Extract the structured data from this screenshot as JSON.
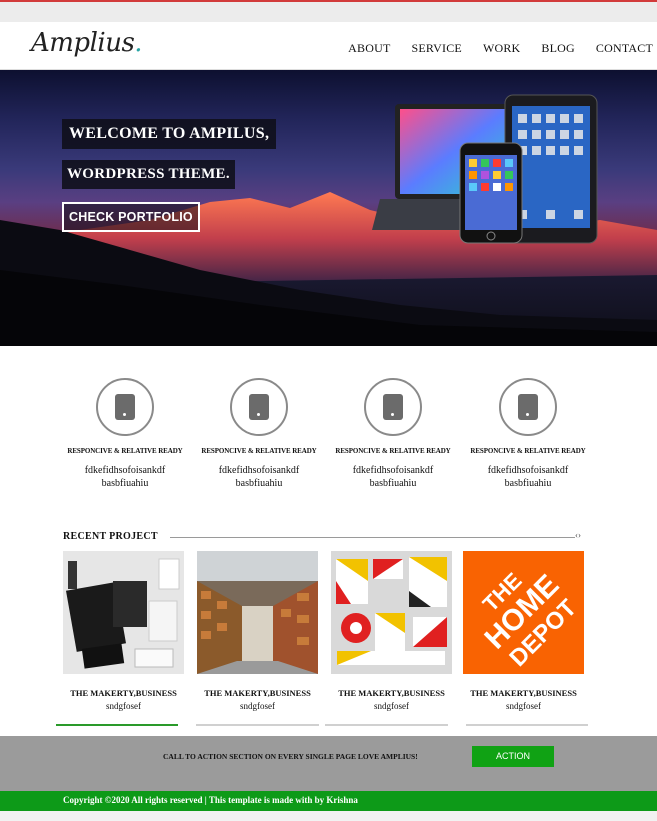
{
  "header": {
    "logo": "Amplius",
    "logo_dot": ".",
    "nav": [
      "ABOUT",
      "SERVICE",
      "WORK",
      "BLOG",
      "CONTACT"
    ]
  },
  "hero": {
    "line1": "WELCOME TO AMPILUS,",
    "line2": "WORDPRESS THEME.",
    "button": "CHECK PORTFOLIO"
  },
  "features": [
    {
      "title": "RESPONCIVE & RELATIVE READY",
      "line1": "fdkefidhsofoisankdf",
      "line2": "basbfiuahiu"
    },
    {
      "title": "RESPONCIVE & RELATIVE READY",
      "line1": "fdkefidhsofoisankdf",
      "line2": "basbfiuahiu"
    },
    {
      "title": "RESPONCIVE & RELATIVE READY",
      "line1": "fdkefidhsofoisankdf",
      "line2": "basbfiuahiu"
    },
    {
      "title": "RESPONCIVE & RELATIVE READY",
      "line1": "fdkefidhsofoisankdf",
      "line2": "basbfiuahiu"
    }
  ],
  "recent": {
    "heading": "RECENT PROJECT",
    "arrows": "‹›",
    "projects": [
      {
        "title": "THE MAKERTY,BUSINESS",
        "subtitle": "sndgfosef",
        "image": "stationery-mockup"
      },
      {
        "title": "THE MAKERTY,BUSINESS",
        "subtitle": "sndgfosef",
        "image": "warehouse-aisle"
      },
      {
        "title": "THE MAKERTY,BUSINESS",
        "subtitle": "sndgfosef",
        "image": "branding-design"
      },
      {
        "title": "THE MAKERTY,BUSINESS",
        "subtitle": "sndgfosef",
        "image": "home-depot-logo"
      }
    ],
    "home_depot_lines": [
      "THE",
      "HOME",
      "DEPOT"
    ]
  },
  "cta": {
    "text": "CALL TO ACTION SECTION ON EVERY SINGLE PAGE LOVE AMPLIUS!",
    "button": "ACTION"
  },
  "footer": {
    "text": "Copyright ©2020 All rights reserved | This template is made with by Krishna"
  },
  "colors": {
    "accent_green": "#10a214",
    "footer_green": "#0d9a18",
    "cta_gray": "#9b9b9b",
    "home_depot_orange": "#f96302"
  }
}
